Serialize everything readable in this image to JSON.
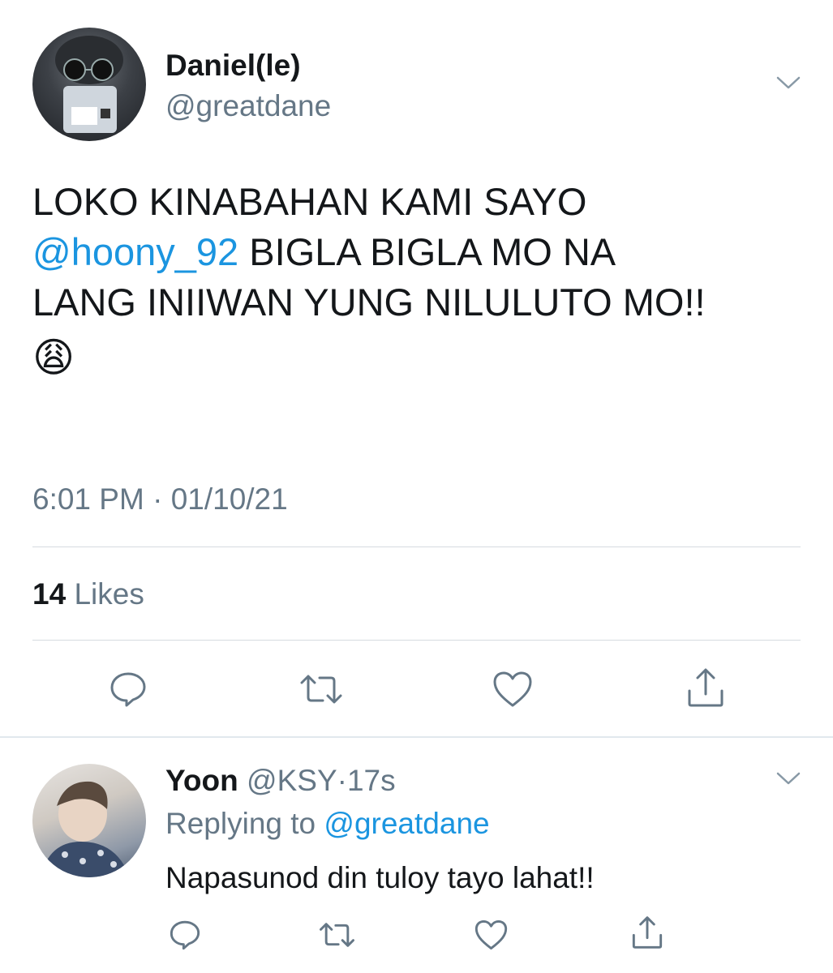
{
  "tweet": {
    "author_name": "Daniel(le)",
    "author_handle": "@greatdane",
    "text_line1": "LOKO KINABAHAN KAMI SAYO",
    "text_mention": "@hoony_92",
    "text_line2_rest": " BIGLA BIGLA MO NA",
    "text_line3": "LANG INIIWAN YUNG NILULUTO MO!!",
    "emoji": "😩",
    "time": "6:01 PM",
    "separator": "·",
    "date": "01/10/21",
    "likes_count": "14",
    "likes_label": "Likes"
  },
  "reply": {
    "author_name": "Yoon",
    "author_handle": "@KSY",
    "separator": "·",
    "age": "17s",
    "replying_prefix": "Replying to",
    "replying_to": "@greatdane",
    "text": "Napasunod din tuloy tayo lahat!!"
  },
  "colors": {
    "accent": "#1b95e0",
    "muted": "#657786",
    "text": "#14171a"
  },
  "icons": {
    "menu": "chevron-down-icon",
    "reply": "comment-icon",
    "retweet": "retweet-icon",
    "like": "heart-icon",
    "share": "share-icon"
  }
}
